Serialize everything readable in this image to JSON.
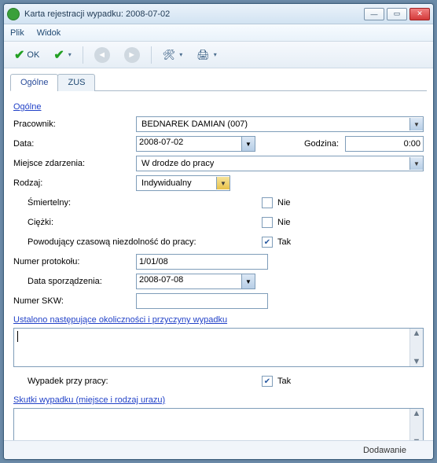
{
  "window": {
    "title": "Karta rejestracji wypadku: 2008-07-02"
  },
  "menu": {
    "file": "Plik",
    "view": "Widok"
  },
  "toolbar": {
    "ok": "OK"
  },
  "tabs": {
    "general": "Ogólne",
    "zus": "ZUS"
  },
  "section": {
    "general": "Ogólne",
    "circumstances": "Ustalono następujące okoliczności i przyczyny wypadku",
    "effects": "Skutki wypadku (miejsce i rodzaj urazu)"
  },
  "labels": {
    "employee": "Pracownik:",
    "date": "Data:",
    "hour": "Godzina:",
    "event_place": "Miejsce zdarzenia:",
    "kind": "Rodzaj:",
    "fatal": "Śmiertelny:",
    "severe": "Ciężki:",
    "temp_disability": "Powodujący czasową niezdolność do pracy:",
    "protocol_no": "Numer protokołu:",
    "prepared_date": "Data sporządzenia:",
    "skw_no": "Numer SKW:",
    "accident_at_work": "Wypadek przy pracy:"
  },
  "values": {
    "employee": "BEDNAREK DAMIAN (007)",
    "date": "2008-07-02",
    "hour": "0:00",
    "event_place": "W drodze do pracy",
    "kind": "Indywidualny",
    "fatal_checked": false,
    "fatal_text": "Nie",
    "severe_checked": false,
    "severe_text": "Nie",
    "temp_disability_checked": true,
    "temp_disability_text": "Tak",
    "protocol_no": "1/01/08",
    "prepared_date": "2008-07-08",
    "skw_no": "",
    "accident_at_work_checked": true,
    "accident_at_work_text": "Tak"
  },
  "status": {
    "mode": "Dodawanie"
  }
}
